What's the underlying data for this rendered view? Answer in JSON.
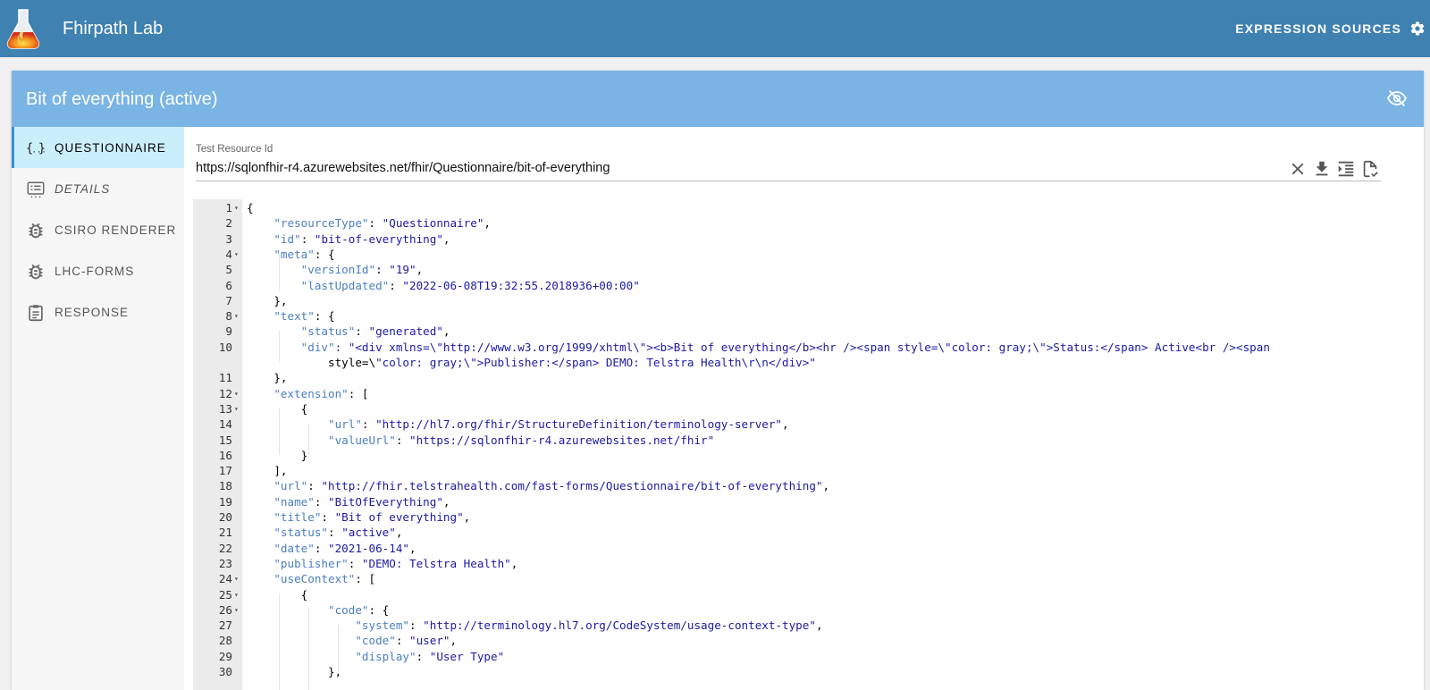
{
  "app": {
    "title": "Fhirpath Lab",
    "expression_sources_label": "EXPRESSION SOURCES"
  },
  "card": {
    "title": "Bit of everything (active)"
  },
  "sidebar": {
    "items": [
      {
        "label": "QUESTIONNAIRE",
        "icon": "json-braces-icon",
        "active": true,
        "italic": false
      },
      {
        "label": "DETAILS",
        "icon": "list-details-icon",
        "active": false,
        "italic": true
      },
      {
        "label": "CSIRO RENDERER",
        "icon": "bug-report-icon",
        "active": false,
        "italic": false
      },
      {
        "label": "LHC-FORMS",
        "icon": "bug-report-icon",
        "active": false,
        "italic": false
      },
      {
        "label": "RESPONSE",
        "icon": "clipboard-icon",
        "active": false,
        "italic": false
      }
    ]
  },
  "resource_field": {
    "label": "Test Resource Id",
    "value": "https://sqlonfhir-r4.azurewebsites.net/fhir/Questionnaire/bit-of-everything"
  },
  "editor": {
    "lines": [
      {
        "n": "1",
        "fold": true,
        "text": "{"
      },
      {
        "n": "2",
        "fold": false,
        "text": "    \"resourceType\": \"Questionnaire\","
      },
      {
        "n": "3",
        "fold": false,
        "text": "    \"id\": \"bit-of-everything\","
      },
      {
        "n": "4",
        "fold": true,
        "text": "    \"meta\": {"
      },
      {
        "n": "5",
        "fold": false,
        "text": "        \"versionId\": \"19\","
      },
      {
        "n": "6",
        "fold": false,
        "text": "        \"lastUpdated\": \"2022-06-08T19:32:55.2018936+00:00\""
      },
      {
        "n": "7",
        "fold": false,
        "text": "    },"
      },
      {
        "n": "8",
        "fold": true,
        "text": "    \"text\": {"
      },
      {
        "n": "9",
        "fold": false,
        "text": "        \"status\": \"generated\","
      },
      {
        "n": "10",
        "fold": false,
        "text": "        \"div\": \"<div xmlns=\\\"http://www.w3.org/1999/xhtml\\\"><b>Bit of everything</b><hr /><span style=\\\"color: gray;\\\">Status:</span> Active<br /><span"
      },
      {
        "n": "",
        "fold": false,
        "text": "            style=\\\"color: gray;\\\">Publisher:</span> DEMO: Telstra Health\\r\\n</div>\""
      },
      {
        "n": "11",
        "fold": false,
        "text": "    },"
      },
      {
        "n": "12",
        "fold": true,
        "text": "    \"extension\": ["
      },
      {
        "n": "13",
        "fold": true,
        "text": "        {"
      },
      {
        "n": "14",
        "fold": false,
        "text": "            \"url\": \"http://hl7.org/fhir/StructureDefinition/terminology-server\","
      },
      {
        "n": "15",
        "fold": false,
        "text": "            \"valueUrl\": \"https://sqlonfhir-r4.azurewebsites.net/fhir\""
      },
      {
        "n": "16",
        "fold": false,
        "text": "        }"
      },
      {
        "n": "17",
        "fold": false,
        "text": "    ],"
      },
      {
        "n": "18",
        "fold": false,
        "text": "    \"url\": \"http://fhir.telstrahealth.com/fast-forms/Questionnaire/bit-of-everything\","
      },
      {
        "n": "19",
        "fold": false,
        "text": "    \"name\": \"BitOfEverything\","
      },
      {
        "n": "20",
        "fold": false,
        "text": "    \"title\": \"Bit of everything\","
      },
      {
        "n": "21",
        "fold": false,
        "text": "    \"status\": \"active\","
      },
      {
        "n": "22",
        "fold": false,
        "text": "    \"date\": \"2021-06-14\","
      },
      {
        "n": "23",
        "fold": false,
        "text": "    \"publisher\": \"DEMO: Telstra Health\","
      },
      {
        "n": "24",
        "fold": true,
        "text": "    \"useContext\": ["
      },
      {
        "n": "25",
        "fold": true,
        "text": "        {"
      },
      {
        "n": "26",
        "fold": true,
        "text": "            \"code\": {"
      },
      {
        "n": "27",
        "fold": false,
        "text": "                \"system\": \"http://terminology.hl7.org/CodeSystem/usage-context-type\","
      },
      {
        "n": "28",
        "fold": false,
        "text": "                \"code\": \"user\","
      },
      {
        "n": "29",
        "fold": false,
        "text": "                \"display\": \"User Type\""
      },
      {
        "n": "30",
        "fold": false,
        "text": "            },"
      }
    ]
  },
  "colors": {
    "appbar": "#3f81b1",
    "card_header": "#7ab4e5",
    "active_nav": "#cbeefb",
    "json_key": "#4a7fc1",
    "json_string": "#1a1aa6"
  }
}
